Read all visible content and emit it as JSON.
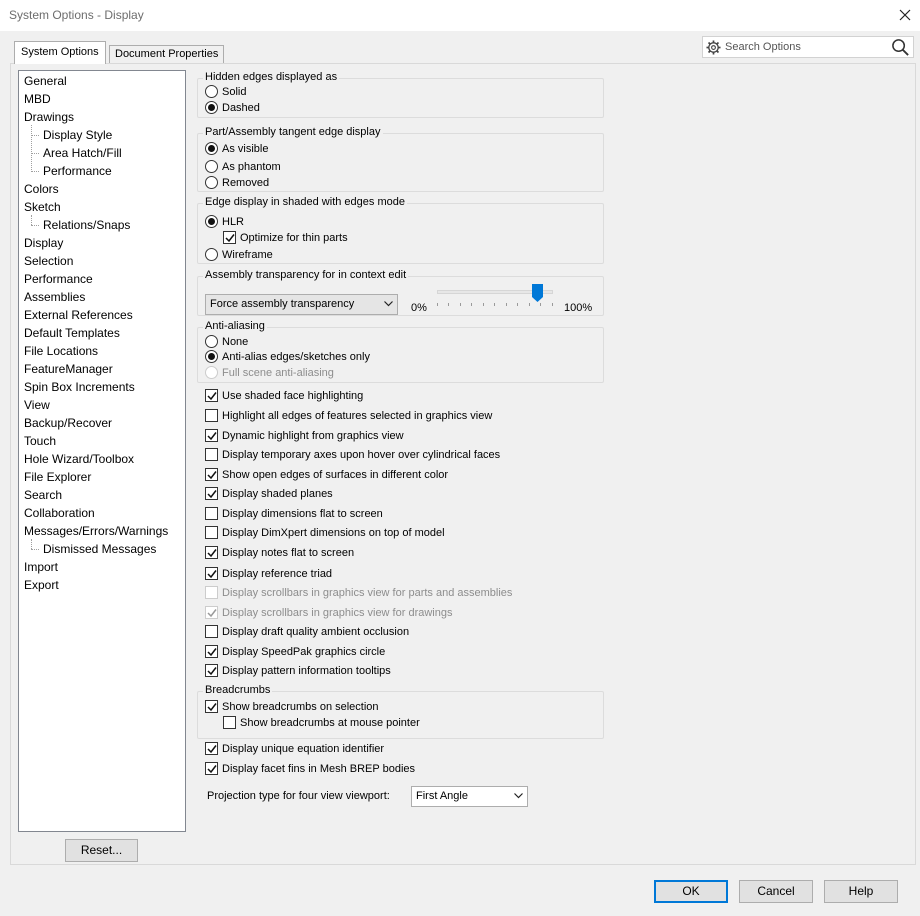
{
  "window": {
    "title": "System Options - Display"
  },
  "tabs": [
    {
      "label": "System Options",
      "active": true
    },
    {
      "label": "Document Properties",
      "active": false
    }
  ],
  "search": {
    "placeholder": "Search Options",
    "value": ""
  },
  "tree": {
    "items": [
      {
        "label": "General",
        "level": 0
      },
      {
        "label": "MBD",
        "level": 0
      },
      {
        "label": "Drawings",
        "level": 0
      },
      {
        "label": "Display Style",
        "level": 1
      },
      {
        "label": "Area Hatch/Fill",
        "level": 1
      },
      {
        "label": "Performance",
        "level": 1
      },
      {
        "label": "Colors",
        "level": 0
      },
      {
        "label": "Sketch",
        "level": 0
      },
      {
        "label": "Relations/Snaps",
        "level": 1
      },
      {
        "label": "Display",
        "level": 0,
        "selected": true
      },
      {
        "label": "Selection",
        "level": 0
      },
      {
        "label": "Performance",
        "level": 0
      },
      {
        "label": "Assemblies",
        "level": 0
      },
      {
        "label": "External References",
        "level": 0
      },
      {
        "label": "Default Templates",
        "level": 0
      },
      {
        "label": "File Locations",
        "level": 0
      },
      {
        "label": "FeatureManager",
        "level": 0
      },
      {
        "label": "Spin Box Increments",
        "level": 0
      },
      {
        "label": "View",
        "level": 0
      },
      {
        "label": "Backup/Recover",
        "level": 0
      },
      {
        "label": "Touch",
        "level": 0
      },
      {
        "label": "Hole Wizard/Toolbox",
        "level": 0
      },
      {
        "label": "File Explorer",
        "level": 0
      },
      {
        "label": "Search",
        "level": 0
      },
      {
        "label": "Collaboration",
        "level": 0
      },
      {
        "label": "Messages/Errors/Warnings",
        "level": 0
      },
      {
        "label": "Dismissed Messages",
        "level": 1
      },
      {
        "label": "Import",
        "level": 0
      },
      {
        "label": "Export",
        "level": 0
      }
    ],
    "reset_label": "Reset..."
  },
  "hidden_edges": {
    "title": "Hidden edges displayed as",
    "options": [
      {
        "label": "Solid",
        "selected": false
      },
      {
        "label": "Dashed",
        "selected": true
      }
    ]
  },
  "tangent_edges": {
    "title": "Part/Assembly tangent edge display",
    "options": [
      {
        "label": "As visible",
        "selected": true
      },
      {
        "label": "As phantom",
        "selected": false
      },
      {
        "label": "Removed",
        "selected": false
      }
    ]
  },
  "shaded_edges": {
    "title": "Edge display in shaded with edges mode",
    "hlr_label": "HLR",
    "hlr_selected": true,
    "optimize_label": "Optimize for thin parts",
    "optimize_checked": true,
    "wireframe_label": "Wireframe",
    "wireframe_selected": false
  },
  "transparency": {
    "title": "Assembly transparency for in context edit",
    "dropdown_value": "Force assembly transparency",
    "min_label": "0%",
    "max_label": "100%",
    "slider_fraction": 0.87
  },
  "antialiasing": {
    "title": "Anti-aliasing",
    "options": [
      {
        "label": "None",
        "selected": false,
        "disabled": false
      },
      {
        "label": "Anti-alias edges/sketches only",
        "selected": true,
        "disabled": false
      },
      {
        "label": "Full scene anti-aliasing",
        "selected": false,
        "disabled": true
      }
    ]
  },
  "checks": [
    {
      "label": "Use shaded face highlighting",
      "checked": true,
      "disabled": false
    },
    {
      "label": "Highlight all edges of features selected in graphics view",
      "checked": false,
      "disabled": false
    },
    {
      "label": "Dynamic highlight from graphics view",
      "checked": true,
      "disabled": false
    },
    {
      "label": "Display temporary axes upon hover over cylindrical faces",
      "checked": false,
      "disabled": false
    },
    {
      "label": "Show open edges of surfaces in different color",
      "checked": true,
      "disabled": false
    },
    {
      "label": "Display shaded planes",
      "checked": true,
      "disabled": false
    },
    {
      "label": "Display dimensions flat to screen",
      "checked": false,
      "disabled": false
    },
    {
      "label": "Display DimXpert dimensions on top of model",
      "checked": false,
      "disabled": false
    },
    {
      "label": "Display notes flat to screen",
      "checked": true,
      "disabled": false
    },
    {
      "label": "Display reference triad",
      "checked": true,
      "disabled": false
    },
    {
      "label": "Display scrollbars in graphics view for parts and assemblies",
      "checked": false,
      "disabled": true
    },
    {
      "label": "Display scrollbars in graphics view for drawings",
      "checked": true,
      "disabled": true
    },
    {
      "label": "Display draft quality ambient occlusion",
      "checked": false,
      "disabled": false
    },
    {
      "label": "Display SpeedPak graphics circle",
      "checked": true,
      "disabled": false
    },
    {
      "label": "Display pattern information tooltips",
      "checked": true,
      "disabled": false
    }
  ],
  "breadcrumbs": {
    "title": "Breadcrumbs",
    "on_selection_label": "Show breadcrumbs on selection",
    "on_selection_checked": true,
    "at_pointer_label": "Show breadcrumbs at mouse pointer",
    "at_pointer_checked": false
  },
  "bottom_checks": [
    {
      "label": "Display unique equation identifier",
      "checked": true
    },
    {
      "label": "Display facet fins in Mesh BREP bodies",
      "checked": true
    }
  ],
  "projection": {
    "label": "Projection type for four view viewport:",
    "value": "First Angle"
  },
  "buttons": {
    "ok": "OK",
    "cancel": "Cancel",
    "help": "Help"
  }
}
